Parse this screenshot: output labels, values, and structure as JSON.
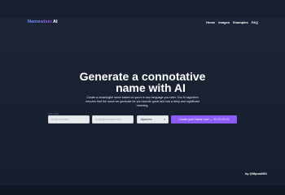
{
  "brand": {
    "name": "Namewiser",
    "suffix": "AI"
  },
  "nav": {
    "home": "Home",
    "images": "Images",
    "examples": "Examples",
    "faq": "FAQ"
  },
  "hero": {
    "title_line1": "Generate a connotative",
    "title_line2": "name with AI",
    "description": "Create a meaningful name based on yours in any language you wish. Our AI algorithm ensures that the name we generate for you sounds great and has a deep and significant meaning."
  },
  "form": {
    "label": "First name",
    "name_placeholder": "Emily Wonder",
    "email_placeholder": "emily@example.com",
    "language_value": "Japanese",
    "cta_label": "Create your Name now —",
    "cta_price": "$2.99 $3.99"
  },
  "footer": {
    "credit": "by @Nipunk061"
  },
  "colors": {
    "background": "#1c2436",
    "accent": "#8b5cf6",
    "brand_gradient_start": "#60a5fa",
    "brand_gradient_end": "#a855f7"
  }
}
